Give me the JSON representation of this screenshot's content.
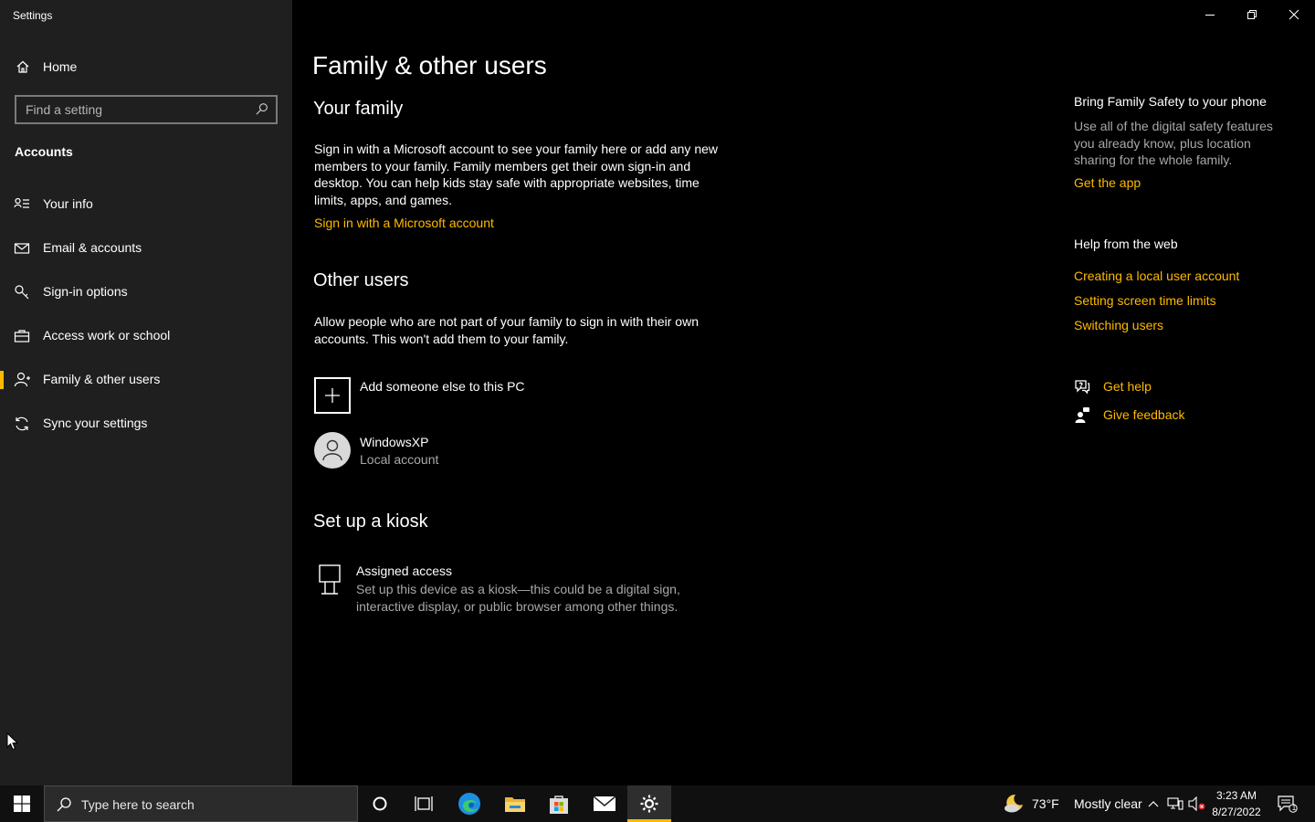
{
  "window": {
    "title": "Settings"
  },
  "sidebar": {
    "home_label": "Home",
    "search_placeholder": "Find a setting",
    "section_heading": "Accounts",
    "items": [
      {
        "label": "Your info",
        "icon": "contact-card-icon",
        "active": false
      },
      {
        "label": "Email & accounts",
        "icon": "mail-icon",
        "active": false
      },
      {
        "label": "Sign-in options",
        "icon": "key-icon",
        "active": false
      },
      {
        "label": "Access work or school",
        "icon": "briefcase-icon",
        "active": false
      },
      {
        "label": "Family & other users",
        "icon": "person-add-icon",
        "active": true
      },
      {
        "label": "Sync your settings",
        "icon": "sync-icon",
        "active": false
      }
    ]
  },
  "main": {
    "title": "Family & other users",
    "your_family": {
      "heading": "Your family",
      "description": "Sign in with a Microsoft account to see your family here or add any new members to your family. Family members get their own sign-in and desktop. You can help kids stay safe with appropriate websites, time limits, apps, and games.",
      "link": "Sign in with a Microsoft account"
    },
    "other_users": {
      "heading": "Other users",
      "description": "Allow people who are not part of your family to sign in with their own accounts. This won't add them to your family.",
      "add_label": "Add someone else to this PC",
      "users": [
        {
          "name": "WindowsXP",
          "type": "Local account"
        }
      ]
    },
    "kiosk": {
      "heading": "Set up a kiosk",
      "title": "Assigned access",
      "description": "Set up this device as a kiosk—this could be a digital sign, interactive display, or public browser among other things."
    }
  },
  "right_column": {
    "family_safety": {
      "heading": "Bring Family Safety to your phone",
      "text": "Use all of the digital safety features you already know, plus location sharing for the whole family.",
      "link": "Get the app"
    },
    "help_web": {
      "heading": "Help from the web",
      "links": [
        "Creating a local user account",
        "Setting screen time limits",
        "Switching users"
      ]
    },
    "get_help": "Get help",
    "give_feedback": "Give feedback"
  },
  "taskbar": {
    "search_placeholder": "Type here to search",
    "weather": {
      "temp": "73°F",
      "condition": "Mostly clear",
      "icon": "moon-cloud-icon"
    },
    "clock": {
      "time": "3:23 AM",
      "date": "8/27/2022"
    },
    "notification_count": "1",
    "pinned": [
      "cortana-icon",
      "task-view-icon",
      "edge-icon",
      "file-explorer-icon",
      "store-icon",
      "mail-icon",
      "settings-icon"
    ]
  },
  "colors": {
    "accent": "#ffb900",
    "sidebar_bg": "#1f1f1f",
    "main_bg": "#000000",
    "secondary_text": "#a8a8a8"
  }
}
